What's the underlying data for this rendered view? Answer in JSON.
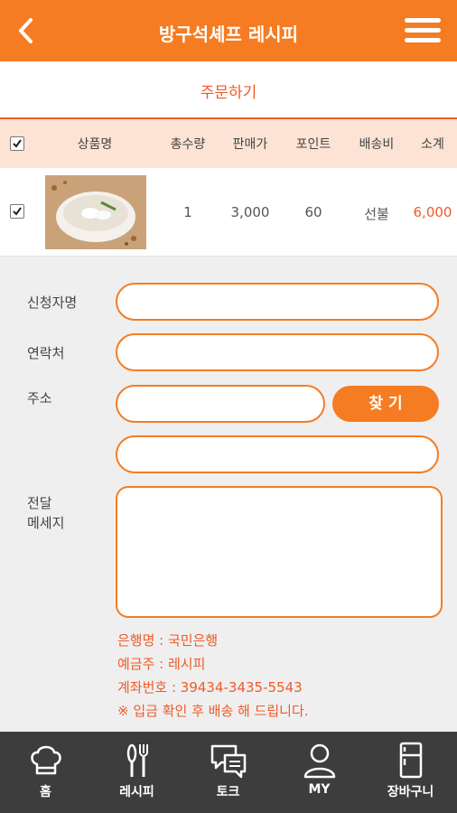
{
  "header": {
    "title": "방구석셰프 레시피"
  },
  "subheader": {
    "title": "주문하기"
  },
  "table": {
    "columns": [
      "상품명",
      "총수량",
      "판매가",
      "포인트",
      "배송비",
      "소계"
    ],
    "rows": [
      {
        "quantity": "1",
        "price": "3,000",
        "points": "60",
        "shipping": "선불",
        "subtotal": "6,000",
        "image": "rice-cake-soup-bowl"
      }
    ]
  },
  "form": {
    "name_label": "신청자명",
    "contact_label": "연락처",
    "address_label": "주소",
    "find_button": "찾 기",
    "message_label_line1": "전달",
    "message_label_line2": "메세지"
  },
  "bank": {
    "bank_name": "은행명 : 국민은행",
    "depositor": "예금주 : 레시피",
    "account": "계좌번호 : 39434-3435-5543",
    "notice": "※ 입금 확인 후 배송 해 드립니다."
  },
  "tabs": [
    {
      "label": "홈",
      "icon": "chef-hat-icon"
    },
    {
      "label": "레시피",
      "icon": "utensils-icon"
    },
    {
      "label": "토크",
      "icon": "chat-bubbles-icon"
    },
    {
      "label": "MY",
      "icon": "user-icon"
    },
    {
      "label": "장바구니",
      "icon": "fridge-icon"
    }
  ],
  "colors": {
    "accent": "#f57c22",
    "text_accent": "#f05a28",
    "header_row": "#fde3d3",
    "tabbar": "#3d3d3d"
  }
}
